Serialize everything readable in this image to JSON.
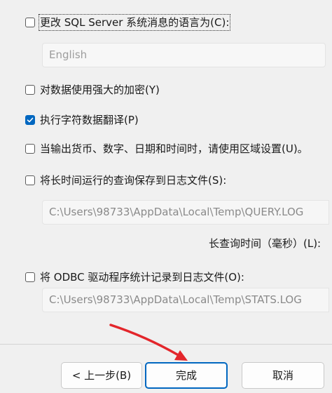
{
  "options": {
    "change_language": {
      "label": "更改 SQL Server 系统消息的语言为(C):",
      "checked": false
    },
    "language_select": {
      "value": "English"
    },
    "strong_encryption": {
      "label": "对数据使用强大的加密(Y)",
      "checked": false
    },
    "translate_char_data": {
      "label": "执行字符数据翻译(P)",
      "checked": true
    },
    "use_regional_settings": {
      "label": "当输出货币、数字、日期和时间时，请使用区域设置(U)。",
      "checked": false
    },
    "save_long_queries": {
      "label": "将长时间运行的查询保存到日志文件(S):",
      "checked": false,
      "path": "C:\\Users\\98733\\AppData\\Local\\Temp\\QUERY.LOG",
      "long_query_label": "长查询时间（毫秒）(L):"
    },
    "log_odbc_stats": {
      "label": "将 ODBC 驱动程序统计记录到日志文件(O):",
      "checked": false,
      "path": "C:\\Users\\98733\\AppData\\Local\\Temp\\STATS.LOG"
    }
  },
  "buttons": {
    "back": "< 上一步(B)",
    "finish": "完成",
    "cancel": "取消"
  },
  "colors": {
    "accent": "#0067c0",
    "annotation_arrow": "#e3262b"
  }
}
